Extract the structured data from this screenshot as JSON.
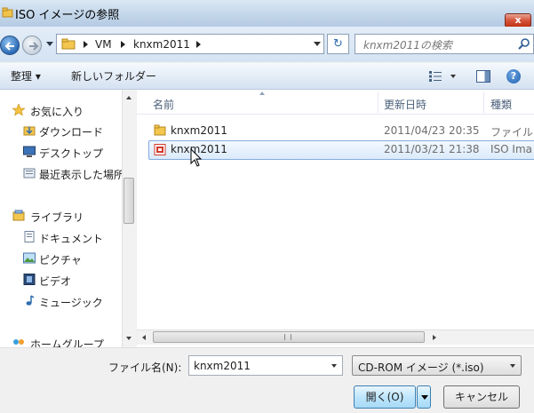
{
  "window": {
    "title": "ISO イメージの参照",
    "close_glyph": "x"
  },
  "nav": {
    "breadcrumb": [
      "VM",
      "knxm2011"
    ],
    "search_placeholder": "knxm2011の検索",
    "refresh_glyph": "↻"
  },
  "toolbar": {
    "organize_label": "整理 ▾",
    "new_folder_label": "新しいフォルダー",
    "help_glyph": "?"
  },
  "sidebar": {
    "favorites": {
      "label": "お気に入り",
      "icon": "star-icon"
    },
    "favorites_items": [
      {
        "label": "ダウンロード",
        "icon": "downloads-folder-icon"
      },
      {
        "label": "デスクトップ",
        "icon": "desktop-icon"
      },
      {
        "label": "最近表示した場所",
        "icon": "recent-places-icon"
      }
    ],
    "libraries": {
      "label": "ライブラリ",
      "icon": "library-icon"
    },
    "library_items": [
      {
        "label": "ドキュメント",
        "icon": "document-icon"
      },
      {
        "label": "ピクチャ",
        "icon": "picture-icon"
      },
      {
        "label": "ビデオ",
        "icon": "video-icon"
      },
      {
        "label": "ミュージック",
        "icon": "music-icon"
      }
    ],
    "homegroup": {
      "label": "ホームグループ",
      "icon": "homegroup-icon"
    }
  },
  "file_list": {
    "columns": [
      "名前",
      "更新日時",
      "種類"
    ],
    "rows": [
      {
        "name": "knxm2011",
        "modified": "2011/04/23 20:35",
        "type": "ファイル",
        "icon": "folder-icon",
        "selected": false
      },
      {
        "name": "knxm2011",
        "modified": "2011/03/21 21:38",
        "type": "ISO Ima",
        "icon": "iso-file-icon",
        "selected": true
      }
    ]
  },
  "bottom": {
    "filename_label": "ファイル名(N):",
    "filename_value": "knxm2011",
    "filter_value": "CD-ROM イメージ (*.iso)",
    "open_label": "開く(O)",
    "cancel_label": "キャンセル"
  },
  "colors": {
    "accent": "#3c7fb1",
    "selection": "#dbeafb",
    "close": "#c03314"
  }
}
